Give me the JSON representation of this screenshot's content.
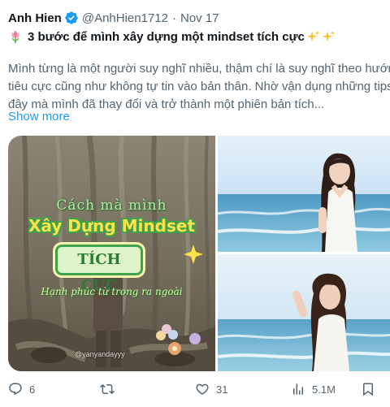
{
  "tweet": {
    "author_name": "Anh Hien",
    "handle": "@AnhHien1712",
    "separator": "·",
    "date": "Nov 17",
    "title": "3 bước để mình xây dựng một mindset tích cực",
    "body_lines": [
      "Mình từng là một người suy nghĩ nhiều, thậm chí là suy nghĩ theo hướng",
      "tiêu cực cũng như không tự tin vào bản thân. Nhờ vận dụng những tips",
      "đây mà mình đã thay đổi và trở thành một phiên bản tích..."
    ],
    "show_more": "Show more"
  },
  "image_overlay": {
    "line1": "Cách mà mình",
    "line2": "Xây Dựng Mindset",
    "line3": "TÍCH CỰC",
    "line4": "Hạnh phúc từ trong ra ngoài",
    "watermark": "@yanyandayyy"
  },
  "actions": {
    "reply_count": "6",
    "retweet_count": "",
    "like_count": "31",
    "views_count": "5.1M"
  },
  "colors": {
    "accent": "#1d9bf0",
    "text_primary": "#0f1419",
    "text_secondary": "#536471",
    "overlay_title_yellow": "#ffe24a",
    "overlay_green": "#3fa34d"
  },
  "icons": [
    "verified-badge-icon",
    "tulip-icon",
    "sparkle-icon",
    "reply-icon",
    "retweet-icon",
    "like-icon",
    "views-icon",
    "bookmark-icon",
    "share-icon"
  ]
}
